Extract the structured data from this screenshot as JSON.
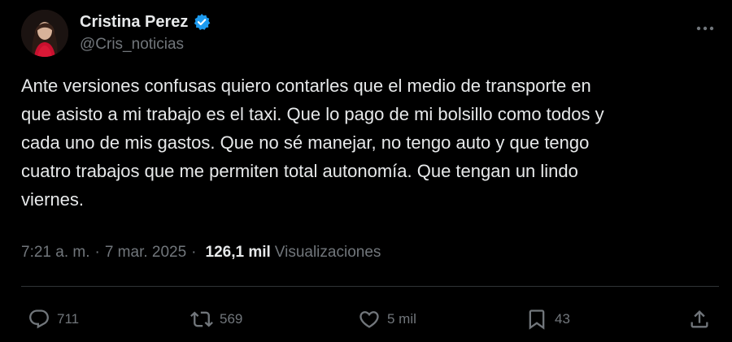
{
  "author": {
    "display_name": "Cristina Perez",
    "handle": "@Cris_noticias",
    "verified": true
  },
  "tweet": {
    "text": "Ante versiones confusas quiero contarles que el medio de transporte en\nque asisto a mi trabajo es el taxi. Que lo pago de mi bolsillo como todos y\ncada uno de mis gastos. Que no sé manejar, no tengo auto y que tengo\ncuatro trabajos que me permiten total autonomía. Que tengan un lindo\nviernes."
  },
  "meta": {
    "time": "7:21 a. m.",
    "date": "7 mar. 2025",
    "views_count": "126,1 mil",
    "views_label": "Visualizaciones",
    "separator": "·"
  },
  "actions": {
    "replies": "711",
    "reposts": "569",
    "likes": "5 mil",
    "bookmarks": "43"
  },
  "icons": {
    "verified": "verified-badge-icon",
    "more": "more-options-icon",
    "reply": "reply-icon",
    "repost": "repost-icon",
    "like": "heart-icon",
    "bookmark": "bookmark-icon",
    "share": "share-icon"
  },
  "colors": {
    "background": "#000000",
    "text": "#e7e9ea",
    "secondary": "#71767b",
    "verified": "#1d9bf0"
  }
}
